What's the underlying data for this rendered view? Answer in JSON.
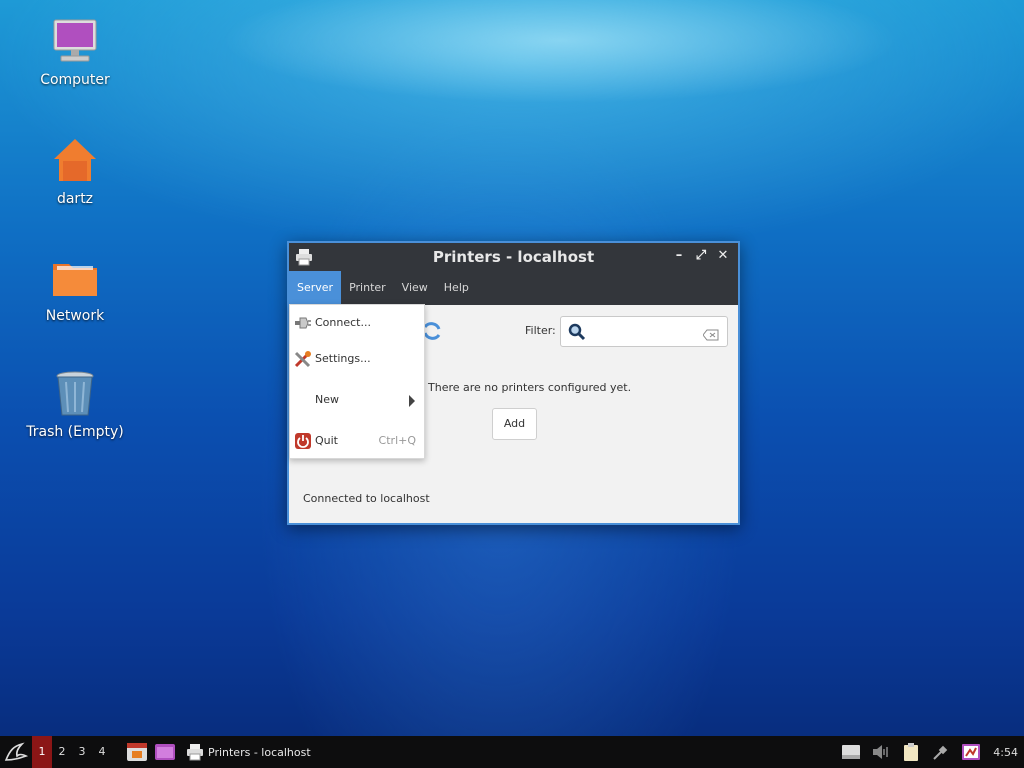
{
  "desktop": {
    "icons": [
      {
        "label": "Computer",
        "icon": "computer-icon"
      },
      {
        "label": "dartz",
        "icon": "home-folder-icon"
      },
      {
        "label": "Network",
        "icon": "network-folder-icon"
      },
      {
        "label": "Trash (Empty)",
        "icon": "trash-icon"
      }
    ]
  },
  "window": {
    "title": "Printers - localhost",
    "menu": [
      "Server",
      "Printer",
      "View",
      "Help"
    ],
    "active_menu": "Server",
    "filter_label": "Filter:",
    "filter_value": "",
    "empty_message": "There are no printers configured yet.",
    "add_button": "Add",
    "status": "Connected to localhost"
  },
  "server_menu": {
    "items": [
      {
        "label": "Connect...",
        "icon": "plug-icon",
        "accel": ""
      },
      {
        "label": "Settings...",
        "icon": "tools-icon",
        "accel": ""
      },
      {
        "label": "New",
        "icon": "",
        "accel": "",
        "submenu": true
      },
      {
        "label": "Quit",
        "icon": "power-icon",
        "accel": "Ctrl+Q"
      }
    ]
  },
  "taskbar": {
    "workspaces": [
      "1",
      "2",
      "3",
      "4"
    ],
    "active_workspace": "1",
    "task_label": "Printers - localhost",
    "clock": "4:54"
  },
  "colors": {
    "accent": "#4a90d9",
    "titlebar": "#33363b",
    "workspace_active": "#8b1616"
  }
}
